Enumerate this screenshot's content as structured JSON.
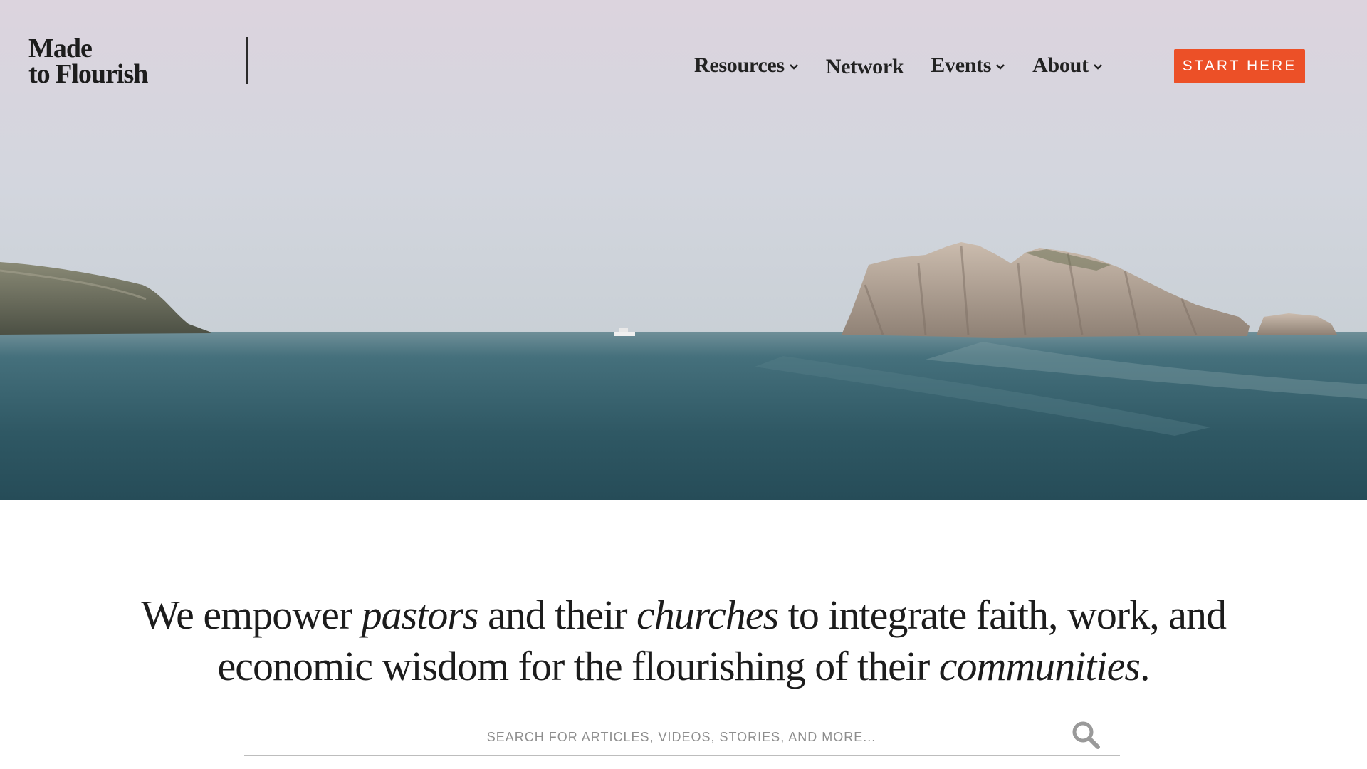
{
  "header": {
    "logo_line1": "Made",
    "logo_line2": "to Flourish",
    "nav": [
      {
        "label": "Resources",
        "has_dropdown": true
      },
      {
        "label": "Network",
        "has_dropdown": false
      },
      {
        "label": "Events",
        "has_dropdown": true
      },
      {
        "label": "About",
        "has_dropdown": true
      }
    ],
    "cta_label": "START HERE"
  },
  "mission": {
    "p1": "We empower ",
    "em1": "pastors",
    "p2": " and their ",
    "em2": "churches",
    "p3": " to integrate faith, work, and economic wisdom for the flourishing of their ",
    "em3": "communities",
    "p4": "."
  },
  "search": {
    "placeholder": "SEARCH FOR ARTICLES, VIDEOS, STORIES, AND MORE...",
    "icon": "search-icon"
  },
  "colors": {
    "accent": "#ec5027",
    "text": "#1c1c1c",
    "sky": "#d9d5de",
    "sea": "#2f5a66"
  }
}
